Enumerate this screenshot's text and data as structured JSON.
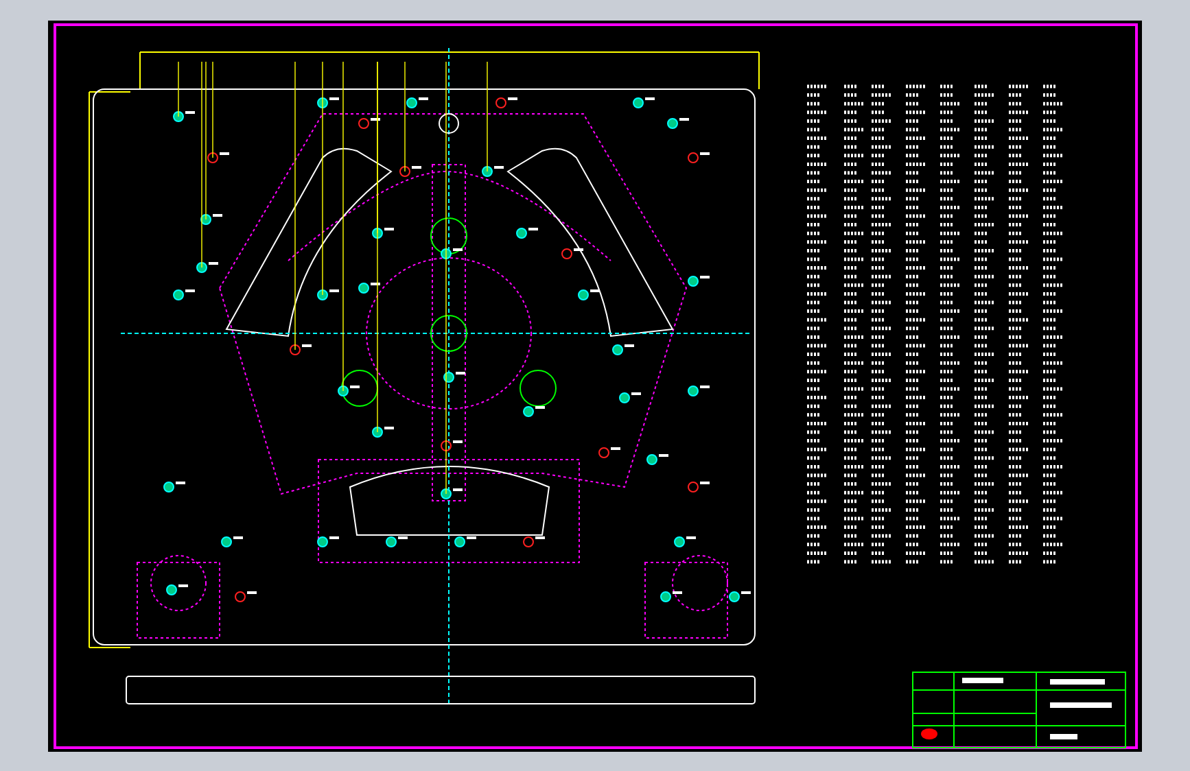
{
  "sheet": {
    "kind": "cad"
  }
}
